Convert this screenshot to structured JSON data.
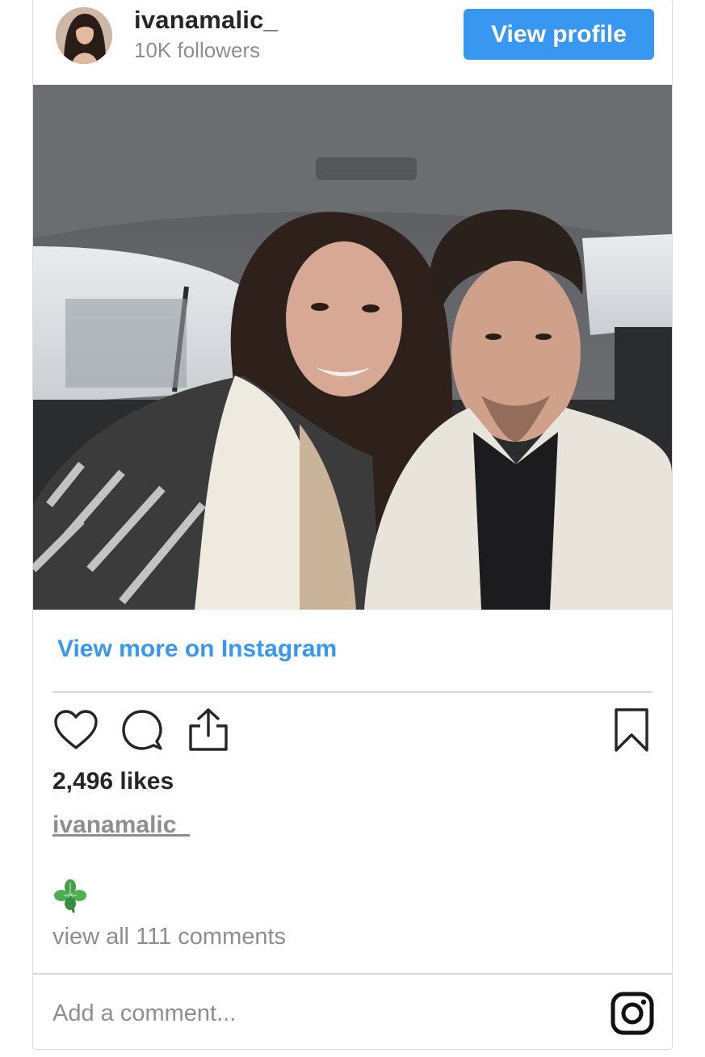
{
  "header": {
    "username": "ivanamalic_",
    "followers": "10K followers",
    "view_profile_label": "View profile"
  },
  "view_more_label": "View more on Instagram",
  "stats": {
    "likes": "2,496 likes"
  },
  "caption": {
    "username": "ivanamalic_",
    "text_emoji": "four-leaf-clover-emoji"
  },
  "view_all_comments": "view all 111 comments",
  "comment_input": {
    "placeholder": "Add a comment..."
  },
  "icons": {
    "like": "heart-icon",
    "comment": "comment-bubble-icon",
    "share": "share-icon",
    "save": "bookmark-icon",
    "brand": "instagram-icon"
  },
  "colors": {
    "accent": "#3897f0",
    "text": "#262626",
    "muted": "#8e8e8e",
    "border": "#dbdbdb"
  }
}
